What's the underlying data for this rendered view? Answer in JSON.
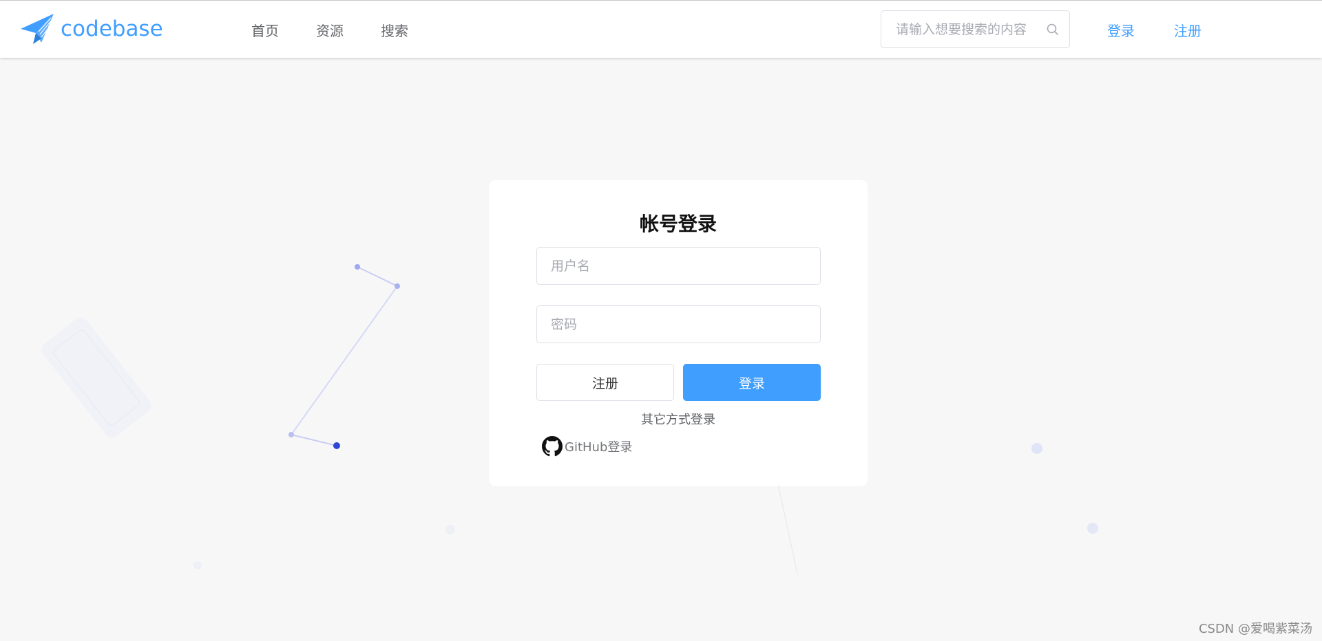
{
  "header": {
    "logo_text": "codebase",
    "nav": [
      {
        "label": "首页"
      },
      {
        "label": "资源"
      },
      {
        "label": "搜索"
      }
    ],
    "search": {
      "placeholder": "请输入想要搜索的内容",
      "icon": "search-icon"
    },
    "login_label": "登录",
    "register_label": "注册"
  },
  "login_card": {
    "title": "帐号登录",
    "username_placeholder": "用户名",
    "password_placeholder": "密码",
    "register_button": "注册",
    "login_button": "登录",
    "other_methods_label": "其它方式登录",
    "github": {
      "label": "GitHub登录",
      "icon": "github-icon"
    }
  },
  "watermark": "CSDN @爱喝紫菜汤",
  "colors": {
    "accent": "#409eff",
    "background": "#f7f7f8",
    "card": "#ffffff"
  }
}
